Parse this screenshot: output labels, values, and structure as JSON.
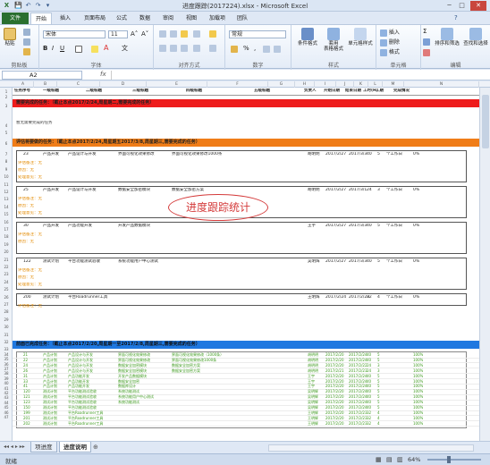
{
  "window": {
    "title": "进度跟踪(2017224).xlsx - Microsoft Excel",
    "qat": [
      "💾",
      "↶",
      "↷",
      "▾"
    ]
  },
  "tabs": [
    "文件",
    "开始",
    "插入",
    "页面布局",
    "公式",
    "数据",
    "审阅",
    "视图",
    "加载项",
    "团队"
  ],
  "ribbon": {
    "groups": [
      "剪贴板",
      "字体",
      "对齐方式",
      "数字",
      "样式",
      "单元格",
      "编辑"
    ],
    "paste": "粘贴",
    "font_name": "宋体",
    "font_size": "11",
    "number_format": "常规",
    "cond_format": "条件格式",
    "table_format": "套用\n表格格式",
    "cell_style": "单元格样式",
    "insert": "插入",
    "delete": "删除",
    "format": "格式",
    "sort": "排序和筛选",
    "find": "查找和选择"
  },
  "formula_bar": {
    "name_box": "A2",
    "fx": "fx",
    "content": ""
  },
  "columns": [
    "A",
    "B",
    "C",
    "D",
    "E",
    "F",
    "G",
    "H",
    "I",
    "J",
    "K",
    "L",
    "M",
    "N"
  ],
  "headers": [
    "任务序号",
    "一级标题",
    "二级标题",
    "三级标题",
    "四级标题",
    "五级标题",
    "负责人",
    "开始日期",
    "结束日期",
    "工时(H)",
    "工期",
    "完成情况"
  ],
  "row_numbers": [
    "1",
    "2",
    "3",
    "4",
    "5",
    "6",
    "7",
    "8",
    "9",
    "10",
    "11",
    "12",
    "13",
    "14",
    "15",
    "16",
    "17",
    "18",
    "19",
    "20",
    "21",
    "22",
    "23",
    "24",
    "25",
    "26",
    "27",
    "28",
    "29",
    "30",
    "31",
    "32",
    "33",
    "34",
    "35",
    "36",
    "37",
    "38",
    "39",
    "40",
    "41",
    "42",
    "43",
    "44",
    "45",
    "46",
    "47"
  ],
  "bands": {
    "red": "需要完成的任务：（截止本点2017/2/24,周星期二,需要完成的任务）",
    "orange": "评估将要做的任务：（截止本点2017/2/24,周星期五2017/3/8,周星期三,需要完成的任务）",
    "blue": "前面已完成任务：（截止本点2017/2/20,周星期一至2017/2/8,周星期三,需要完成的任务）"
  },
  "note_row": "暂无需要完成的任务",
  "watermark": "进度跟踪统计",
  "blocks": [
    {
      "id": "23",
      "l1": "产品开发",
      "l2": "产品设计与开发",
      "l3": "界面可视化效果修改",
      "l4": "界面可视化效果修改1000条",
      "owner": "胡明明",
      "start": "2017/2/27",
      "end": "2017/3/3",
      "hours": "40",
      "days": "5",
      "dur": "个工作日",
      "pct": "0%",
      "notes": [
        "评估备注：无",
        "原因：无",
        "处理意见：无"
      ]
    },
    {
      "id": "25",
      "l1": "产品开发",
      "l2": "产品设计与开发",
      "l3": "数据安全加密模块",
      "l4": "数据安全加密方案",
      "owner": "胡明明",
      "start": "2017/2/27",
      "end": "2017/3/1",
      "hours": "24",
      "days": "3",
      "dur": "个工作日",
      "pct": "0%",
      "notes": [
        "评估备注：无",
        "原因：无",
        "处理意见：无"
      ]
    },
    {
      "id": "30",
      "l1": "产品开发",
      "l2": "产品功能开发",
      "l3": "开发产品数据模块",
      "l4": "",
      "owner": "王宇",
      "start": "2017/2/27",
      "end": "2017/3/3",
      "hours": "40",
      "days": "5",
      "dur": "个工作日",
      "pct": "0%",
      "notes": [
        "评估备注：无",
        "原因：无"
      ]
    },
    {
      "id": "122",
      "l1": "测试计划",
      "l2": "平台功能测试验收",
      "l3": "系统功能用户中心测试",
      "l4": "",
      "owner": "吴明辉",
      "start": "2017/2/27",
      "end": "2017/3/3",
      "hours": "40",
      "days": "5",
      "dur": "个工作日",
      "pct": "0%",
      "notes": [
        "评估备注：无",
        "原因：无",
        "处理意见：无"
      ]
    },
    {
      "id": "200",
      "l1": "测试计划",
      "l2": "平台Roadrunner工具",
      "l3": "",
      "l4": "",
      "owner": "王明辉",
      "start": "2017/2/24",
      "end": "2017/2/28",
      "hours": "32",
      "days": "4",
      "dur": "个工作日",
      "pct": "0%",
      "notes": [
        "评估备注：无"
      ]
    }
  ],
  "done_rows": [
    {
      "id": "21",
      "l1": "产品计划",
      "l2": "产品设计与开发",
      "l3": "界面可视化效果修改",
      "l4": "界面可视化效果修改（1000条）",
      "owner": "胡明明",
      "start": "2017/2/20",
      "end": "2017/2/24",
      "hours": "40",
      "days": "5",
      "pct": "100%"
    },
    {
      "id": "22",
      "l1": "产品计划",
      "l2": "产品设计与开发",
      "l3": "界面可视化效果修改",
      "l4": "界面可视化效果修改1000条",
      "owner": "胡明明",
      "start": "2017/2/20",
      "end": "2017/2/24",
      "hours": "40",
      "days": "5",
      "pct": "100%"
    },
    {
      "id": "24",
      "l1": "产品计划",
      "l2": "产品设计与开发",
      "l3": "数据安全加密模块",
      "l4": "数据安全加密方案",
      "owner": "胡明明",
      "start": "2017/2/20",
      "end": "2017/2/22",
      "hours": "24",
      "days": "3",
      "pct": "100%"
    },
    {
      "id": "26",
      "l1": "产品计划",
      "l2": "产品设计与开发",
      "l3": "数据安全加密模块",
      "l4": "数据安全加密方案",
      "owner": "胡明明",
      "start": "2017/2/21",
      "end": "2017/2/23",
      "hours": "24",
      "days": "3",
      "pct": "100%"
    },
    {
      "id": "31",
      "l1": "产品计划",
      "l2": "产品功能开发",
      "l3": "开发产品数据模块",
      "l4": "",
      "owner": "王宇",
      "start": "2017/2/20",
      "end": "2017/2/24",
      "hours": "40",
      "days": "5",
      "pct": "100%"
    },
    {
      "id": "33",
      "l1": "产品计划",
      "l2": "产品功能开发",
      "l3": "数据安全加密",
      "l4": "",
      "owner": "王宇",
      "start": "2017/2/20",
      "end": "2017/2/24",
      "hours": "40",
      "days": "5",
      "pct": "100%"
    },
    {
      "id": "41",
      "l1": "产品计划",
      "l2": "产品功能开发",
      "l3": "数据库设计",
      "l4": "",
      "owner": "王宇",
      "start": "2017/2/20",
      "end": "2017/2/24",
      "hours": "40",
      "days": "5",
      "pct": "100%"
    },
    {
      "id": "120",
      "l1": "测试计划",
      "l2": "平台功能测试验收",
      "l3": "系统功能测试",
      "l4": "",
      "owner": "吴明辉",
      "start": "2017/2/20",
      "end": "2017/2/24",
      "hours": "40",
      "days": "5",
      "pct": "100%"
    },
    {
      "id": "121",
      "l1": "测试计划",
      "l2": "平台功能测试验收",
      "l3": "系统功能用户中心测试",
      "l4": "",
      "owner": "吴明辉",
      "start": "2017/2/20",
      "end": "2017/2/24",
      "hours": "40",
      "days": "5",
      "pct": "100%"
    },
    {
      "id": "123",
      "l1": "测试计划",
      "l2": "平台功能测试验收",
      "l3": "系统功能测试",
      "l4": "",
      "owner": "吴明辉",
      "start": "2017/2/20",
      "end": "2017/2/24",
      "hours": "40",
      "days": "5",
      "pct": "100%"
    },
    {
      "id": "150",
      "l1": "测试计划",
      "l2": "平台功能测试验收",
      "l3": "",
      "l4": "",
      "owner": "吴明辉",
      "start": "2017/2/20",
      "end": "2017/2/24",
      "hours": "40",
      "days": "5",
      "pct": "100%"
    },
    {
      "id": "199",
      "l1": "测试计划",
      "l2": "平台Roadrunner工具",
      "l3": "",
      "l4": "",
      "owner": "王明辉",
      "start": "2017/2/20",
      "end": "2017/2/23",
      "hours": "32",
      "days": "4",
      "pct": "100%"
    },
    {
      "id": "201",
      "l1": "测试计划",
      "l2": "平台Roadrunner工具",
      "l3": "",
      "l4": "",
      "owner": "王明辉",
      "start": "2017/2/20",
      "end": "2017/2/23",
      "hours": "32",
      "days": "4",
      "pct": "100%"
    },
    {
      "id": "202",
      "l1": "测试计划",
      "l2": "平台Roadrunner工具",
      "l3": "",
      "l4": "",
      "owner": "王明辉",
      "start": "2017/2/20",
      "end": "2017/2/23",
      "hours": "32",
      "days": "4",
      "pct": "100%"
    }
  ],
  "sheets": [
    "项进度",
    "进度说明"
  ],
  "status": {
    "ready": "就绪",
    "zoom": "64%"
  },
  "colors": {
    "red_band": "#ee1c1c",
    "orange_band": "#f07d18",
    "blue_band": "#1f78e0",
    "green_text": "#3d9a1e",
    "orange_text": "#e38a00"
  }
}
